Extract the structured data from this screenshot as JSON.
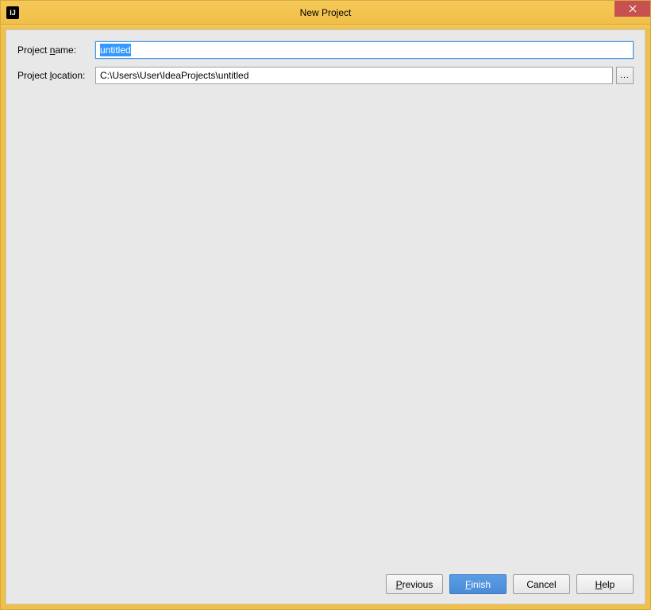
{
  "window": {
    "title": "New Project",
    "icon_text": "IJ"
  },
  "form": {
    "project_name_label_pre": "Project ",
    "project_name_label_u": "n",
    "project_name_label_post": "ame:",
    "project_name_value": "untitled",
    "project_location_label_pre": "Project ",
    "project_location_label_u": "l",
    "project_location_label_post": "ocation:",
    "project_location_value": "C:\\Users\\User\\IdeaProjects\\untitled",
    "browse_label": "..."
  },
  "buttons": {
    "previous_u": "P",
    "previous_rest": "revious",
    "finish_u": "F",
    "finish_rest": "inish",
    "cancel": "Cancel",
    "help_u": "H",
    "help_rest": "elp"
  }
}
